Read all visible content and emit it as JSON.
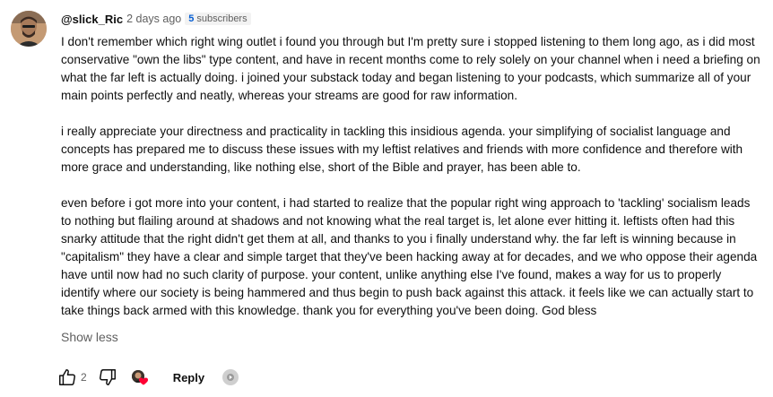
{
  "comment": {
    "author": "@slick_Ric",
    "timestamp": "2 days ago",
    "subscribers_badge": {
      "count": "5",
      "label": "subscribers"
    },
    "paragraphs": [
      "I don't remember which right wing outlet i found you through but I'm pretty sure i stopped listening to them long ago, as i did most conservative \"own the libs\" type content, and have in recent months come to rely solely on your channel when i need a briefing on what the far left is actually doing. i joined your substack today and began listening to your podcasts, which summarize all of your main points perfectly and neatly, whereas your streams are good for raw information.",
      "i really appreciate your directness and practicality in tackling this insidious agenda. your simplifying of socialist language and concepts has prepared me to discuss these issues with my leftist relatives and friends with more confidence and therefore with more grace and understanding, like nothing else, short of the Bible and prayer, has been able to.",
      "even before i got more into your content, i had started to realize that the popular right wing approach to 'tackling' socialism leads to nothing but flailing around at shadows and not knowing what the real target is, let alone ever hitting it. leftists often had this snarky attitude that the right didn't get them at all, and thanks to you i finally understand why. the far left is winning because in \"capitalism\" they have a clear and simple target that they've been hacking away at for decades, and we who oppose their agenda have until now had no such clarity of purpose. your content, unlike anything else I've found, makes a way for us to properly identify where our society is being hammered and thus begin to push back against this attack. it feels like we can actually start to take things back armed with this knowledge. thank you for everything you've been doing. God bless"
    ],
    "show_less_label": "Show less",
    "like_count": "2",
    "reply_label": "Reply",
    "icons": {
      "avatar": "user-avatar",
      "like": "thumbs-up-icon",
      "dislike": "thumbs-down-icon",
      "creator_heart": "creator-heart-icon",
      "more": "more-options-icon"
    },
    "colors": {
      "heart": "#ff0033",
      "badge_count": "#065fd4",
      "muted_text": "#606060"
    }
  }
}
